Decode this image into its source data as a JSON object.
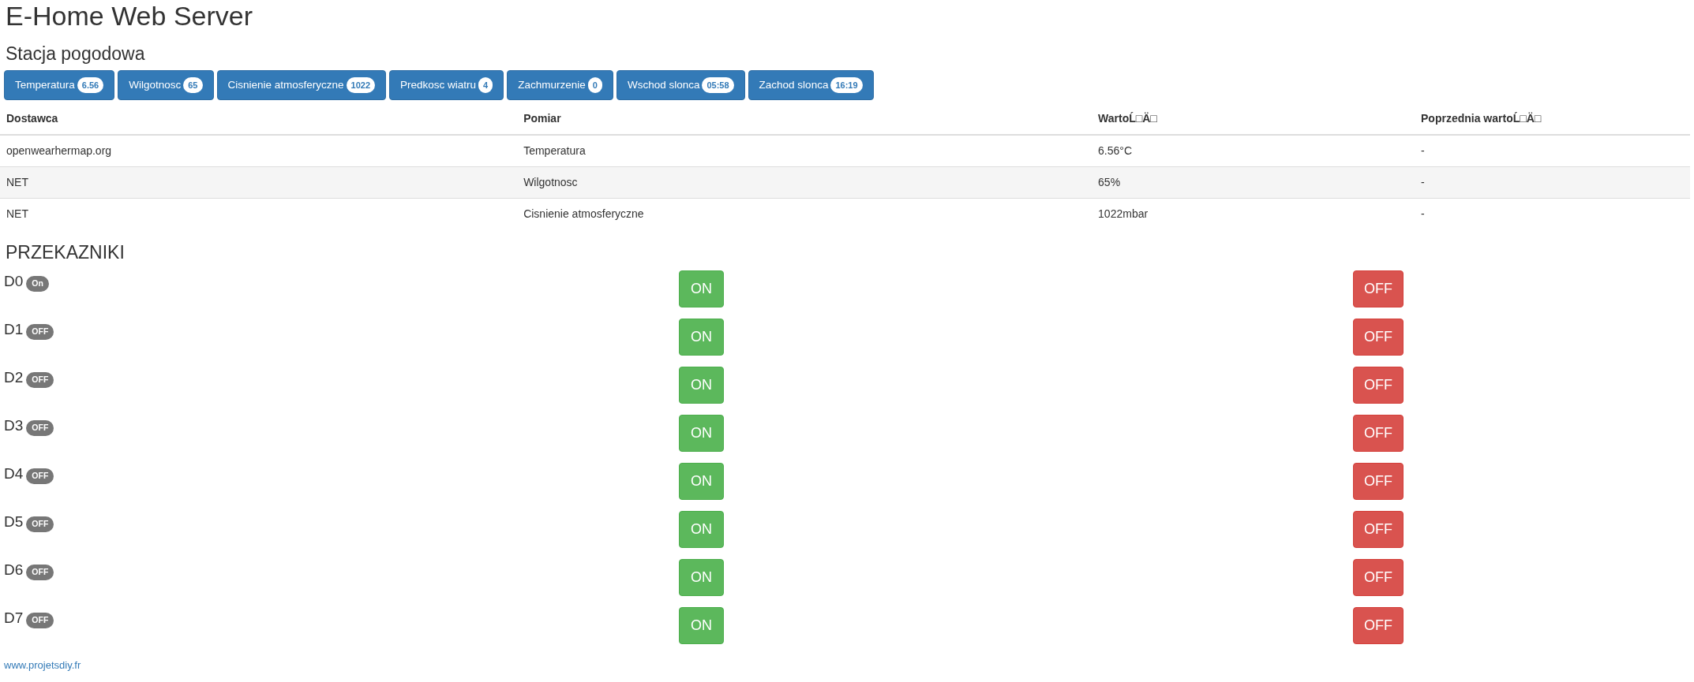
{
  "title": "E-Home Web Server",
  "weather": {
    "heading": "Stacja pogodowa",
    "buttons": [
      {
        "label": "Temperatura",
        "badge": "6.56"
      },
      {
        "label": "Wilgotnosc",
        "badge": "65"
      },
      {
        "label": "Cisnienie atmosferyczne",
        "badge": "1022"
      },
      {
        "label": "Predkosc wiatru",
        "badge": "4"
      },
      {
        "label": "Zachmurzenie",
        "badge": "0"
      },
      {
        "label": "Wschod slonca",
        "badge": "05:58"
      },
      {
        "label": "Zachod slonca",
        "badge": "16:19"
      }
    ],
    "table": {
      "columns": [
        "Dostawca",
        "Pomiar",
        "WartoĹ□Ä□",
        "Poprzednia wartoĹ□Ä□"
      ],
      "rows": [
        [
          "openwearhermap.org",
          "Temperatura",
          "6.56°C",
          "-"
        ],
        [
          "NET",
          "Wilgotnosc",
          "65%",
          "-"
        ],
        [
          "NET",
          "Cisnienie atmosferyczne",
          "1022mbar",
          "-"
        ]
      ]
    }
  },
  "relays": {
    "heading": "PRZEKAZNIKI",
    "items": [
      {
        "name": "D0",
        "state": "On",
        "on_label": "ON",
        "off_label": "OFF"
      },
      {
        "name": "D1",
        "state": "OFF",
        "on_label": "ON",
        "off_label": "OFF"
      },
      {
        "name": "D2",
        "state": "OFF",
        "on_label": "ON",
        "off_label": "OFF"
      },
      {
        "name": "D3",
        "state": "OFF",
        "on_label": "ON",
        "off_label": "OFF"
      },
      {
        "name": "D4",
        "state": "OFF",
        "on_label": "ON",
        "off_label": "OFF"
      },
      {
        "name": "D5",
        "state": "OFF",
        "on_label": "ON",
        "off_label": "OFF"
      },
      {
        "name": "D6",
        "state": "OFF",
        "on_label": "ON",
        "off_label": "OFF"
      },
      {
        "name": "D7",
        "state": "OFF",
        "on_label": "ON",
        "off_label": "OFF"
      }
    ]
  },
  "footer": {
    "link": "www.projetsdiy.fr"
  }
}
